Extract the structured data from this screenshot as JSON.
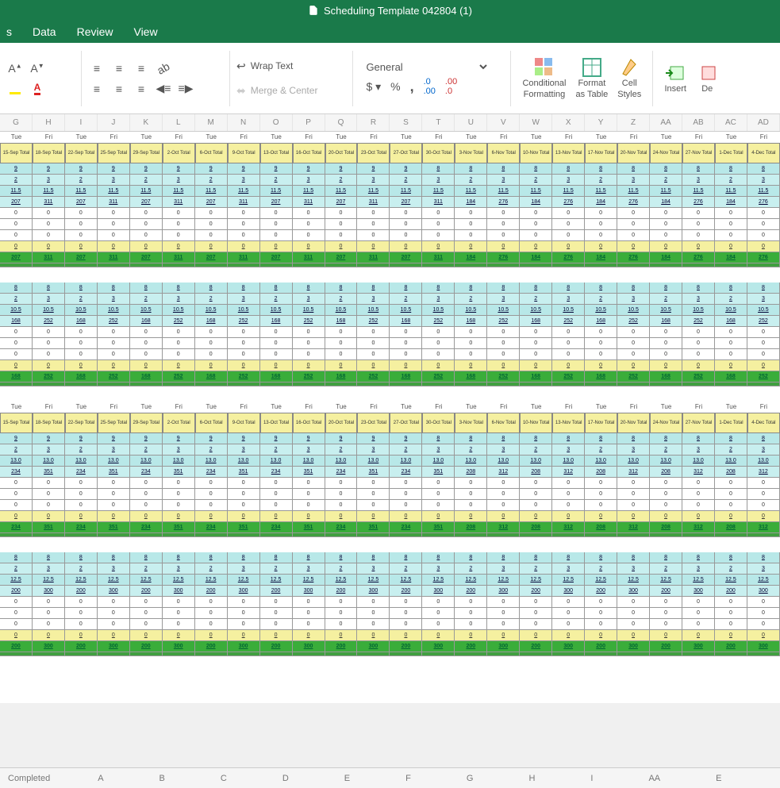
{
  "title": "Scheduling Template 042804 (1)",
  "menu": [
    "s",
    "Data",
    "Review",
    "View"
  ],
  "ribbon": {
    "wrap": "Wrap Text",
    "merge": "Merge & Center",
    "numberFormat": "General",
    "cond": "Conditional",
    "cond2": "Formatting",
    "fmt": "Format",
    "fmt2": "as Table",
    "cell": "Cell",
    "cell2": "Styles",
    "insert": "Insert",
    "del": "De"
  },
  "colHeaders": [
    "G",
    "H",
    "I",
    "J",
    "K",
    "L",
    "M",
    "N",
    "O",
    "P",
    "Q",
    "R",
    "S",
    "T",
    "U",
    "V",
    "W",
    "X",
    "Y",
    "Z",
    "AA",
    "AB",
    "AC",
    "AD"
  ],
  "days": [
    "Tue",
    "Fri",
    "Tue",
    "Fri",
    "Tue",
    "Fri",
    "Tue",
    "Fri",
    "Tue",
    "Fri",
    "Tue",
    "Fri",
    "Tue",
    "Fri",
    "Tue",
    "Fri",
    "Tue",
    "Fri",
    "Tue",
    "Fri",
    "Tue",
    "Fri",
    "Tue",
    "Fri"
  ],
  "dates": [
    "15-Sep Total",
    "18-Sep Total",
    "22-Sep Total",
    "25-Sep Total",
    "29-Sep Total",
    "2-Oct Total",
    "6-Oct Total",
    "9-Oct Total",
    "13-Oct Total",
    "16-Oct Total",
    "20-Oct Total",
    "23-Oct Total",
    "27-Oct Total",
    "30-Oct Total",
    "3-Nov Total",
    "6-Nov Total",
    "10-Nov Total",
    "13-Nov Total",
    "17-Nov Total",
    "20-Nov Total",
    "24-Nov Total",
    "27-Nov Total",
    "1-Dec Total",
    "4-Dec Total"
  ],
  "chart_data": [
    {
      "type": "table",
      "title": "Block 1",
      "rows": [
        [
          "9",
          "9",
          "9",
          "9",
          "9",
          "9",
          "9",
          "9",
          "9",
          "9",
          "9",
          "9",
          "9",
          "8",
          "8",
          "8",
          "8",
          "8",
          "8",
          "8",
          "8",
          "8",
          "8",
          "8"
        ],
        [
          "2",
          "3",
          "2",
          "3",
          "2",
          "3",
          "2",
          "3",
          "2",
          "3",
          "2",
          "3",
          "2",
          "3",
          "2",
          "3",
          "2",
          "3",
          "2",
          "3",
          "2",
          "3",
          "2",
          "3"
        ],
        [
          "11.5",
          "11.5",
          "11.5",
          "11.5",
          "11.5",
          "11.5",
          "11.5",
          "11.5",
          "11.5",
          "11.5",
          "11.5",
          "11.5",
          "11.5",
          "11.5",
          "11.5",
          "11.5",
          "11.5",
          "11.5",
          "11.5",
          "11.5",
          "11.5",
          "11.5",
          "11.5",
          "11.5"
        ],
        [
          "207",
          "311",
          "207",
          "311",
          "207",
          "311",
          "207",
          "311",
          "207",
          "311",
          "207",
          "311",
          "207",
          "311",
          "184",
          "276",
          "184",
          "276",
          "184",
          "276",
          "184",
          "276",
          "184",
          "276"
        ],
        [
          "0",
          "0",
          "0",
          "0",
          "0",
          "0",
          "0",
          "0",
          "0",
          "0",
          "0",
          "0",
          "0",
          "0",
          "0",
          "0",
          "0",
          "0",
          "0",
          "0",
          "0",
          "0",
          "0",
          "0"
        ],
        [
          "0",
          "0",
          "0",
          "0",
          "0",
          "0",
          "0",
          "0",
          "0",
          "0",
          "0",
          "0",
          "0",
          "0",
          "0",
          "0",
          "0",
          "0",
          "0",
          "0",
          "0",
          "0",
          "0",
          "0"
        ],
        [
          "0",
          "0",
          "0",
          "0",
          "0",
          "0",
          "0",
          "0",
          "0",
          "0",
          "0",
          "0",
          "0",
          "0",
          "0",
          "0",
          "0",
          "0",
          "0",
          "0",
          "0",
          "0",
          "0",
          "0"
        ],
        [
          "0",
          "0",
          "0",
          "0",
          "0",
          "0",
          "0",
          "0",
          "0",
          "0",
          "0",
          "0",
          "0",
          "0",
          "0",
          "0",
          "0",
          "0",
          "0",
          "0",
          "0",
          "0",
          "0",
          "0"
        ]
      ],
      "sum": [
        "207",
        "311",
        "207",
        "311",
        "207",
        "311",
        "207",
        "311",
        "207",
        "311",
        "207",
        "311",
        "207",
        "311",
        "184",
        "276",
        "184",
        "276",
        "184",
        "276",
        "184",
        "276",
        "184",
        "276"
      ]
    },
    {
      "type": "table",
      "title": "Block 2",
      "rows": [
        [
          "8",
          "8",
          "8",
          "8",
          "8",
          "8",
          "8",
          "8",
          "8",
          "8",
          "8",
          "8",
          "8",
          "8",
          "8",
          "8",
          "8",
          "8",
          "8",
          "8",
          "8",
          "8",
          "8",
          "8"
        ],
        [
          "2",
          "3",
          "2",
          "3",
          "2",
          "3",
          "2",
          "3",
          "2",
          "3",
          "2",
          "3",
          "2",
          "3",
          "2",
          "3",
          "2",
          "3",
          "2",
          "3",
          "2",
          "3",
          "2",
          "3"
        ],
        [
          "10.5",
          "10.5",
          "10.5",
          "10.5",
          "10.5",
          "10.5",
          "10.5",
          "10.5",
          "10.5",
          "10.5",
          "10.5",
          "10.5",
          "10.5",
          "10.5",
          "10.5",
          "10.5",
          "10.5",
          "10.5",
          "10.5",
          "10.5",
          "10.5",
          "10.5",
          "10.5",
          "10.5"
        ],
        [
          "168",
          "252",
          "168",
          "252",
          "168",
          "252",
          "168",
          "252",
          "168",
          "252",
          "168",
          "252",
          "168",
          "252",
          "168",
          "252",
          "168",
          "252",
          "168",
          "252",
          "168",
          "252",
          "168",
          "252"
        ],
        [
          "0",
          "0",
          "0",
          "0",
          "0",
          "0",
          "0",
          "0",
          "0",
          "0",
          "0",
          "0",
          "0",
          "0",
          "0",
          "0",
          "0",
          "0",
          "0",
          "0",
          "0",
          "0",
          "0",
          "0"
        ],
        [
          "0",
          "0",
          "0",
          "0",
          "0",
          "0",
          "0",
          "0",
          "0",
          "0",
          "0",
          "0",
          "0",
          "0",
          "0",
          "0",
          "0",
          "0",
          "0",
          "0",
          "0",
          "0",
          "0",
          "0"
        ],
        [
          "0",
          "0",
          "0",
          "0",
          "0",
          "0",
          "0",
          "0",
          "0",
          "0",
          "0",
          "0",
          "0",
          "0",
          "0",
          "0",
          "0",
          "0",
          "0",
          "0",
          "0",
          "0",
          "0",
          "0"
        ],
        [
          "0",
          "0",
          "0",
          "0",
          "0",
          "0",
          "0",
          "0",
          "0",
          "0",
          "0",
          "0",
          "0",
          "0",
          "0",
          "0",
          "0",
          "0",
          "0",
          "0",
          "0",
          "0",
          "0",
          "0"
        ]
      ],
      "sum": [
        "168",
        "252",
        "168",
        "252",
        "168",
        "252",
        "168",
        "252",
        "168",
        "252",
        "168",
        "252",
        "168",
        "252",
        "168",
        "252",
        "168",
        "252",
        "168",
        "252",
        "168",
        "252",
        "168",
        "252"
      ]
    },
    {
      "type": "table",
      "title": "Block 3",
      "rows": [
        [
          "9",
          "9",
          "9",
          "9",
          "9",
          "9",
          "9",
          "9",
          "9",
          "9",
          "9",
          "9",
          "9",
          "8",
          "8",
          "8",
          "8",
          "8",
          "8",
          "8",
          "8",
          "8",
          "8",
          "8"
        ],
        [
          "2",
          "3",
          "2",
          "3",
          "2",
          "3",
          "2",
          "3",
          "2",
          "3",
          "2",
          "3",
          "2",
          "3",
          "2",
          "3",
          "2",
          "3",
          "2",
          "3",
          "2",
          "3",
          "2",
          "3"
        ],
        [
          "13.0",
          "13.0",
          "13.0",
          "13.0",
          "13.0",
          "13.0",
          "13.0",
          "13.0",
          "13.0",
          "13.0",
          "13.0",
          "13.0",
          "13.0",
          "13.0",
          "13.0",
          "13.0",
          "13.0",
          "13.0",
          "13.0",
          "13.0",
          "13.0",
          "13.0",
          "13.0",
          "13.0"
        ],
        [
          "234",
          "351",
          "234",
          "351",
          "234",
          "351",
          "234",
          "351",
          "234",
          "351",
          "234",
          "351",
          "234",
          "351",
          "208",
          "312",
          "208",
          "312",
          "208",
          "312",
          "208",
          "312",
          "208",
          "312"
        ],
        [
          "0",
          "0",
          "0",
          "0",
          "0",
          "0",
          "0",
          "0",
          "0",
          "0",
          "0",
          "0",
          "0",
          "0",
          "0",
          "0",
          "0",
          "0",
          "0",
          "0",
          "0",
          "0",
          "0",
          "0"
        ],
        [
          "0",
          "0",
          "0",
          "0",
          "0",
          "0",
          "0",
          "0",
          "0",
          "0",
          "0",
          "0",
          "0",
          "0",
          "0",
          "0",
          "0",
          "0",
          "0",
          "0",
          "0",
          "0",
          "0",
          "0"
        ],
        [
          "0",
          "0",
          "0",
          "0",
          "0",
          "0",
          "0",
          "0",
          "0",
          "0",
          "0",
          "0",
          "0",
          "0",
          "0",
          "0",
          "0",
          "0",
          "0",
          "0",
          "0",
          "0",
          "0",
          "0"
        ],
        [
          "0",
          "0",
          "0",
          "0",
          "0",
          "0",
          "0",
          "0",
          "0",
          "0",
          "0",
          "0",
          "0",
          "0",
          "0",
          "0",
          "0",
          "0",
          "0",
          "0",
          "0",
          "0",
          "0",
          "0"
        ]
      ],
      "sum": [
        "234",
        "351",
        "234",
        "351",
        "234",
        "351",
        "234",
        "351",
        "234",
        "351",
        "234",
        "351",
        "234",
        "351",
        "208",
        "312",
        "208",
        "312",
        "208",
        "312",
        "208",
        "312",
        "208",
        "312"
      ]
    },
    {
      "type": "table",
      "title": "Block 4",
      "rows": [
        [
          "8",
          "8",
          "8",
          "8",
          "8",
          "8",
          "8",
          "8",
          "8",
          "8",
          "8",
          "8",
          "8",
          "8",
          "8",
          "8",
          "8",
          "8",
          "8",
          "8",
          "8",
          "8",
          "8",
          "8"
        ],
        [
          "2",
          "3",
          "2",
          "3",
          "2",
          "3",
          "2",
          "3",
          "2",
          "3",
          "2",
          "3",
          "2",
          "3",
          "2",
          "3",
          "2",
          "3",
          "2",
          "3",
          "2",
          "3",
          "2",
          "3"
        ],
        [
          "12.5",
          "12.5",
          "12.5",
          "12.5",
          "12.5",
          "12.5",
          "12.5",
          "12.5",
          "12.5",
          "12.5",
          "12.5",
          "12.5",
          "12.5",
          "12.5",
          "12.5",
          "12.5",
          "12.5",
          "12.5",
          "12.5",
          "12.5",
          "12.5",
          "12.5",
          "12.5",
          "12.5"
        ],
        [
          "200",
          "300",
          "200",
          "300",
          "200",
          "300",
          "200",
          "300",
          "200",
          "300",
          "200",
          "300",
          "200",
          "300",
          "200",
          "300",
          "200",
          "300",
          "200",
          "300",
          "200",
          "300",
          "200",
          "300"
        ],
        [
          "0",
          "0",
          "0",
          "0",
          "0",
          "0",
          "0",
          "0",
          "0",
          "0",
          "0",
          "0",
          "0",
          "0",
          "0",
          "0",
          "0",
          "0",
          "0",
          "0",
          "0",
          "0",
          "0",
          "0"
        ],
        [
          "0",
          "0",
          "0",
          "0",
          "0",
          "0",
          "0",
          "0",
          "0",
          "0",
          "0",
          "0",
          "0",
          "0",
          "0",
          "0",
          "0",
          "0",
          "0",
          "0",
          "0",
          "0",
          "0",
          "0"
        ],
        [
          "0",
          "0",
          "0",
          "0",
          "0",
          "0",
          "0",
          "0",
          "0",
          "0",
          "0",
          "0",
          "0",
          "0",
          "0",
          "0",
          "0",
          "0",
          "0",
          "0",
          "0",
          "0",
          "0",
          "0"
        ],
        [
          "0",
          "0",
          "0",
          "0",
          "0",
          "0",
          "0",
          "0",
          "0",
          "0",
          "0",
          "0",
          "0",
          "0",
          "0",
          "0",
          "0",
          "0",
          "0",
          "0",
          "0",
          "0",
          "0",
          "0"
        ]
      ],
      "sum": [
        "200",
        "300",
        "200",
        "300",
        "200",
        "300",
        "200",
        "300",
        "200",
        "300",
        "200",
        "300",
        "200",
        "300",
        "200",
        "300",
        "200",
        "300",
        "200",
        "300",
        "200",
        "300",
        "200",
        "300"
      ]
    }
  ],
  "status": {
    "label": "Completed",
    "cols": [
      "A",
      "B",
      "C",
      "D",
      "E",
      "F",
      "G",
      "H",
      "I",
      "AA",
      "E"
    ]
  }
}
